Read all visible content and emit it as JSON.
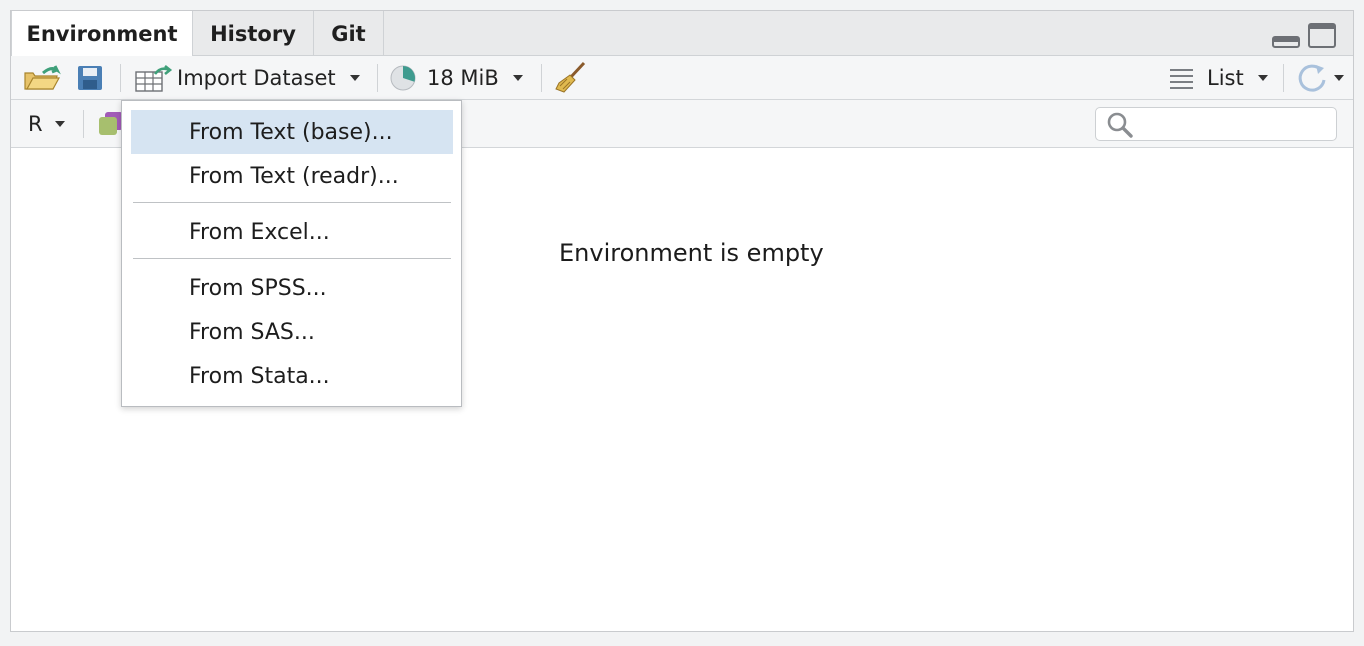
{
  "tabs": [
    {
      "label": "Environment",
      "active": true
    },
    {
      "label": "History",
      "active": false
    },
    {
      "label": "Git",
      "active": false
    }
  ],
  "toolbar": {
    "import_dataset_label": "Import Dataset",
    "memory_label": "18 MiB",
    "view_mode_label": "List"
  },
  "toolbar2": {
    "language_label": "R"
  },
  "search": {
    "placeholder": ""
  },
  "main": {
    "empty_message": "Environment is empty"
  },
  "import_menu": {
    "items": [
      {
        "label": "From Text (base)...",
        "highlighted": true
      },
      {
        "label": "From Text (readr)..."
      },
      {
        "label": "From Excel..."
      },
      {
        "label": "From SPSS..."
      },
      {
        "label": "From SAS..."
      },
      {
        "label": "From Stata..."
      }
    ]
  },
  "colors": {
    "menu_highlight": "#d6e4f2",
    "tabbar_bg": "#e9eaeb",
    "toolbar_bg": "#f5f6f7",
    "icon_green": "#3fa07a",
    "icon_blue": "#4a7fb5"
  }
}
